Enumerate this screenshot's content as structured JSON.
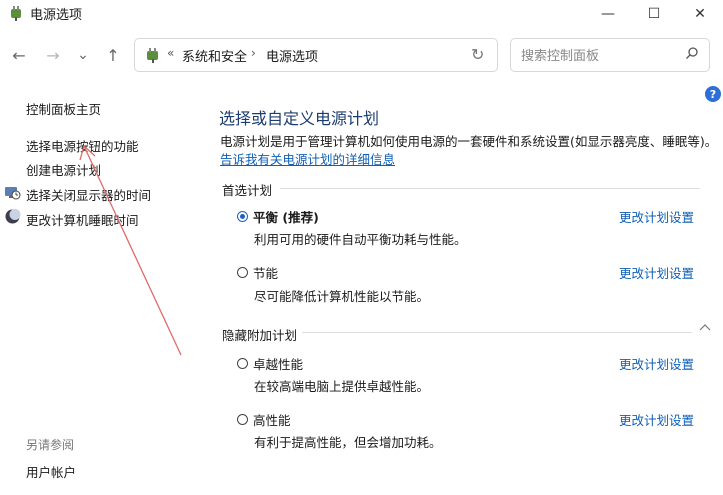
{
  "window": {
    "title": "电源选项",
    "controls": {
      "minimize": "—",
      "maximize": "☐",
      "close": "✕"
    }
  },
  "navigation": {
    "back": "←",
    "forward": "→",
    "recent": "⌄",
    "up": "↑",
    "breadcrumb_prefix": "«",
    "breadcrumbs": [
      "系统和安全",
      "电源选项"
    ],
    "separator": "›",
    "refresh": "↻"
  },
  "search": {
    "placeholder": "搜索控制面板",
    "value": ""
  },
  "help": {
    "label": "?"
  },
  "sidebar": {
    "items": [
      {
        "label": "控制面板主页",
        "icon": null
      },
      {
        "label": "选择电源按钮的功能",
        "icon": null
      },
      {
        "label": "创建电源计划",
        "icon": null
      },
      {
        "label": "选择关闭显示器的时间",
        "icon": "monitor-clock-icon"
      },
      {
        "label": "更改计算机睡眠时间",
        "icon": "moon-sleep-icon"
      }
    ],
    "see_also_title": "另请参阅",
    "see_also_items": [
      {
        "label": "用户帐户"
      }
    ]
  },
  "main": {
    "title": "选择或自定义电源计划",
    "description": "电源计划是用于管理计算机如何使用电源的一套硬件和系统设置(如显示器亮度、睡眠等)。",
    "description_link": "告诉我有关电源计划的详细信息",
    "preferred_section": "首选计划",
    "hidden_section": "隐藏附加计划",
    "plans": [
      {
        "name": "平衡 (推荐)",
        "description": "利用可用的硬件自动平衡功耗与性能。",
        "selected": true,
        "link": "更改计划设置"
      },
      {
        "name": "节能",
        "description": "尽可能降低计算机性能以节能。",
        "selected": false,
        "link": "更改计划设置"
      },
      {
        "name": "卓越性能",
        "description": "在较高端电脑上提供卓越性能。",
        "selected": false,
        "link": "更改计划设置"
      },
      {
        "name": "高性能",
        "description": "有利于提高性能，但会增加功耗。",
        "selected": false,
        "link": "更改计划设置"
      }
    ]
  },
  "annotation": {
    "color": "#e06a6a"
  }
}
